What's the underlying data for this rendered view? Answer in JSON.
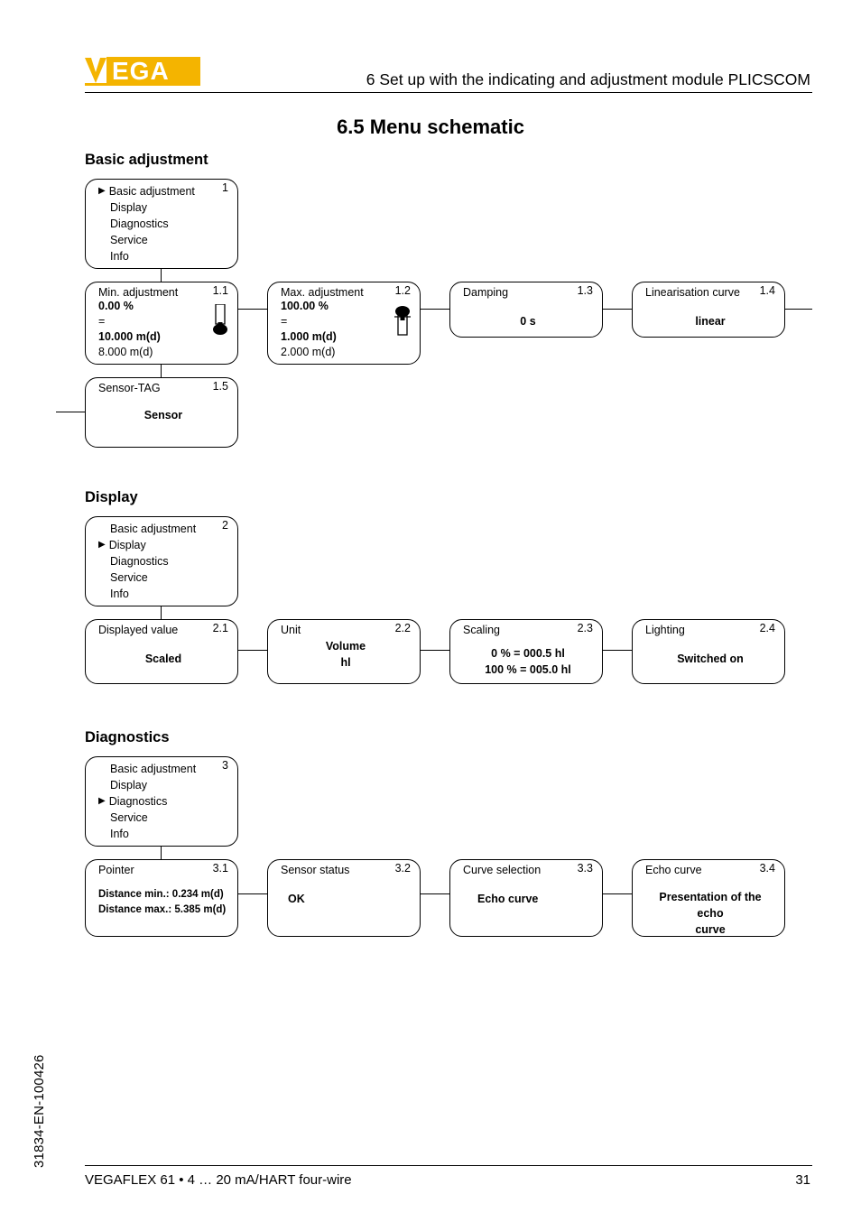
{
  "header": {
    "chapter_line": "6  Set up with the indicating and adjustment module PLICSCOM",
    "section_title": "6.5   Menu schematic"
  },
  "groups": {
    "basic": {
      "title": "Basic adjustment",
      "main_card": {
        "num": "1",
        "items": [
          "Basic adjustment",
          "Display",
          "Diagnostics",
          "Service",
          "Info"
        ],
        "active_index": 0
      },
      "row": [
        {
          "num": "1.1",
          "title": "Min. adjustment",
          "lines": [
            "0.00 %",
            "=",
            "10.000 m(d)",
            "8.000 m(d)"
          ],
          "bold_flags": [
            true,
            false,
            true,
            false
          ]
        },
        {
          "num": "1.2",
          "title": "Max. adjustment",
          "lines": [
            "100.00 %",
            "=",
            "1.000 m(d)",
            "2.000 m(d)"
          ],
          "bold_flags": [
            true,
            false,
            true,
            false
          ]
        },
        {
          "num": "1.3",
          "title": "Damping",
          "center": "0 s"
        },
        {
          "num": "1.4",
          "title": "Linearisation curve",
          "center": "linear"
        }
      ],
      "second_row": {
        "num": "1.5",
        "title": "Sensor-TAG",
        "center": "Sensor"
      }
    },
    "display": {
      "title": "Display",
      "main_card": {
        "num": "2",
        "items": [
          "Basic adjustment",
          "Display",
          "Diagnostics",
          "Service",
          "Info"
        ],
        "active_index": 1
      },
      "row": [
        {
          "num": "2.1",
          "title": "Displayed value",
          "center": "Scaled"
        },
        {
          "num": "2.2",
          "title": "Unit",
          "center_lines": [
            "Volume",
            "hl"
          ]
        },
        {
          "num": "2.3",
          "title": "Scaling",
          "center_lines": [
            "0 % = 000.5 hl",
            "100 % = 005.0 hl"
          ]
        },
        {
          "num": "2.4",
          "title": "Lighting",
          "center": "Switched on"
        }
      ]
    },
    "diagnostics": {
      "title": "Diagnostics",
      "main_card": {
        "num": "3",
        "items": [
          "Basic adjustment",
          "Display",
          "Diagnostics",
          "Service",
          "Info"
        ],
        "active_index": 2
      },
      "row": [
        {
          "num": "3.1",
          "title": "Pointer",
          "center_lines_left": [
            "Distance min.: 0.234 m(d)",
            "Distance max.: 5.385 m(d)"
          ]
        },
        {
          "num": "3.2",
          "title": "Sensor status",
          "center": "OK"
        },
        {
          "num": "3.3",
          "title": "Curve selection",
          "center": "Echo curve"
        },
        {
          "num": "3.4",
          "title": "Echo curve",
          "center_lines": [
            "Presentation of the echo",
            "curve"
          ]
        }
      ]
    }
  },
  "footer": {
    "left": "VEGAFLEX 61 • 4 … 20 mA/HART four-wire",
    "page": "31",
    "side_code": "31834-EN-100426"
  },
  "chart_data": null
}
